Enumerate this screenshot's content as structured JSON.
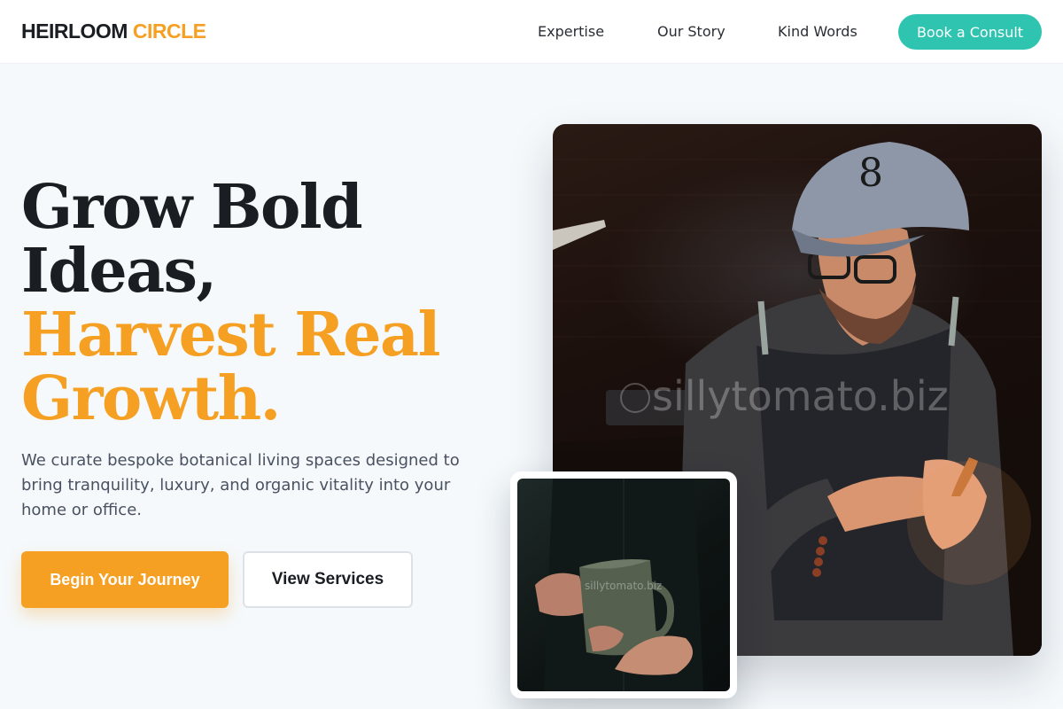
{
  "header": {
    "logo_primary": "HEIRLOOM",
    "logo_accent": "CIRCLE",
    "nav": [
      "Expertise",
      "Our Story",
      "Kind Words"
    ],
    "cta": "Book a Consult"
  },
  "hero": {
    "headline_dark": [
      "Grow Bold",
      "Ideas,"
    ],
    "headline_accent": [
      "Harvest Real",
      "Growth."
    ],
    "subtext": "We curate bespoke botanical living spaces designed to bring tranquility, luxury, and organic vitality into your home or office.",
    "primary_button": "Begin Your Journey",
    "secondary_button": "View Services"
  },
  "images": {
    "main_watermark": "sillytomato.biz",
    "inset_watermark": "sillytomato.biz"
  },
  "colors": {
    "accent_orange": "#f6a023",
    "accent_teal": "#2ec4b0",
    "text_dark": "#1a1d22",
    "background": "#f5f9fc"
  }
}
